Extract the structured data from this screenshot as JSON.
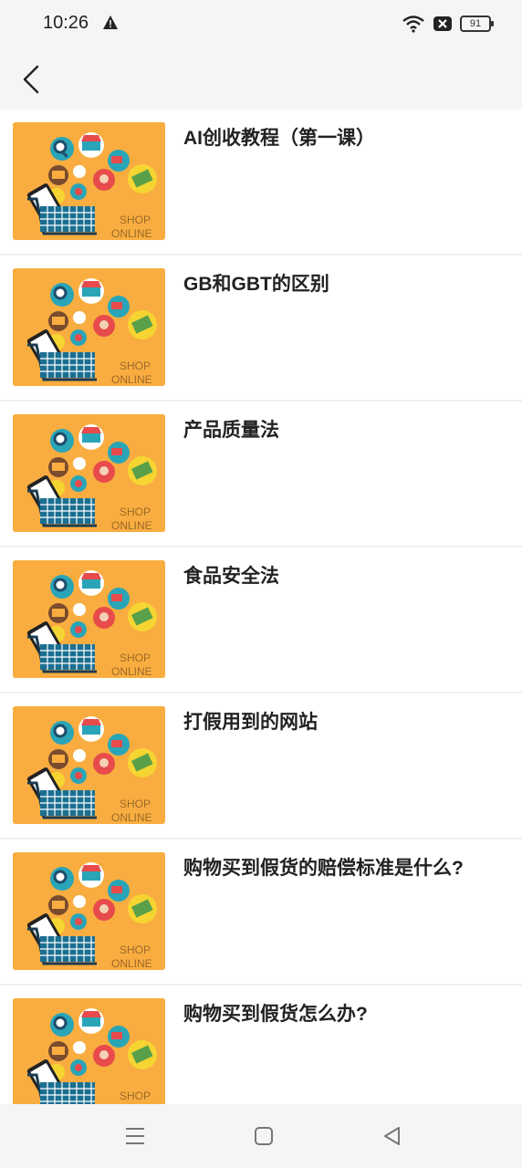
{
  "status_bar": {
    "time": "10:26",
    "battery": "91",
    "icons": [
      "warning-icon",
      "wifi-icon",
      "notification-close-icon",
      "battery-icon"
    ]
  },
  "nav": {
    "back_icon": "chevron-left-icon"
  },
  "thumbnail": {
    "text_line1": "SHOP",
    "text_line2": "ONLINE",
    "background_color": "#f9ad40"
  },
  "list": [
    {
      "title": "AI创收教程（第一课）"
    },
    {
      "title": "GB和GBT的区别"
    },
    {
      "title": "产品质量法"
    },
    {
      "title": "食品安全法"
    },
    {
      "title": "打假用到的网站"
    },
    {
      "title": "购物买到假货的赔偿标准是什么?"
    },
    {
      "title": "购物买到假货怎么办?"
    }
  ],
  "system_nav": {
    "icons": [
      "menu-icon",
      "home-icon",
      "back-triangle-icon"
    ]
  }
}
